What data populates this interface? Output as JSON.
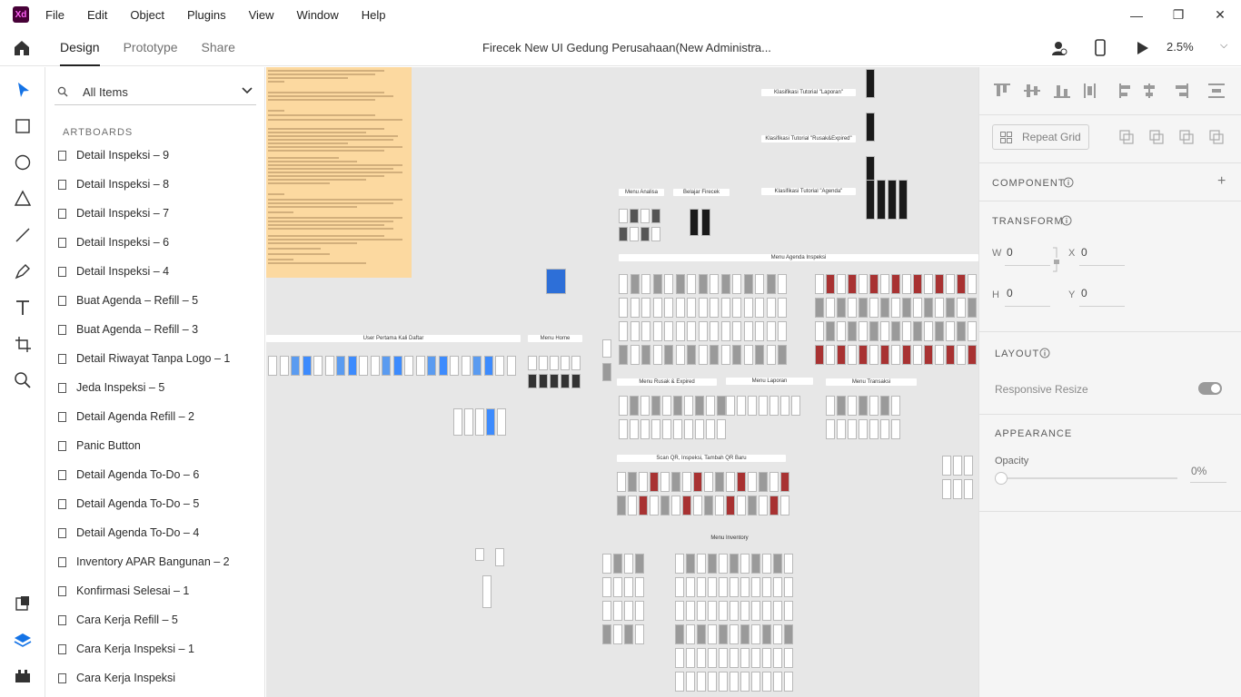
{
  "app": {
    "logo_text": "Xd",
    "brand_color": "#470137"
  },
  "menu": [
    "File",
    "Edit",
    "Object",
    "Plugins",
    "View",
    "Window",
    "Help"
  ],
  "window_controls": {
    "minimize": "—",
    "maximize": "❐",
    "close": "✕"
  },
  "toolbar": {
    "tabs": [
      {
        "label": "Design",
        "active": true
      },
      {
        "label": "Prototype",
        "active": false
      },
      {
        "label": "Share",
        "active": false
      }
    ],
    "doc_title": "Firecek New UI Gedung Perusahaan(New Administra...",
    "zoom": "2.5%"
  },
  "layers": {
    "search_text": "All Items",
    "section": "ARTBOARDS",
    "items": [
      "Detail Inspeksi – 9",
      "Detail Inspeksi – 8",
      "Detail Inspeksi – 7",
      "Detail Inspeksi – 6",
      "Detail Inspeksi – 4",
      "Buat Agenda – Refill – 5",
      "Buat Agenda – Refill – 3",
      "Detail Riwayat Tanpa Logo – 1",
      "Jeda Inspeksi – 5",
      "Detail Agenda Refill – 2",
      "Panic Button",
      "Detail Agenda To-Do – 6",
      "Detail Agenda To-Do – 5",
      "Detail Agenda To-Do – 4",
      "Inventory APAR Bangunan – 2",
      "Konfirmasi Selesai – 1",
      "Cara Kerja Refill – 5",
      "Cara Kerja Inspeksi – 1",
      "Cara Kerja Inspeksi"
    ]
  },
  "canvas": {
    "labels": {
      "user_pertama": "User Pertama Kali Daftar",
      "menu_home": "Menu Home",
      "menu_analisa": "Menu Analisa",
      "belajar": "Belajar Firecek",
      "klasifikasi_laporan": "Klasifikasi Tutorial \"Laporan\"",
      "klasifikasi_rusak": "Klasifikasi Tutorial \"Rusak&Expired\"",
      "klasifikasi_agenda": "Klasifikasi Tutorial \"Agenda\"",
      "menu_agenda": "Menu Agenda Inspeksi",
      "menu_rusak": "Menu Rusak & Expired",
      "menu_laporan": "Menu Laporan",
      "menu_transaksi": "Menu Transaksi",
      "scan_qr": "Scan QR, Inspeksi, Tambah QR Baru",
      "menu_inventory": "Menu Inventory"
    }
  },
  "properties": {
    "repeat_grid": "Repeat Grid",
    "component": "COMPONENT",
    "transform": "TRANSFORM",
    "w_label": "W",
    "w_value": "0",
    "h_label": "H",
    "h_value": "0",
    "x_label": "X",
    "x_value": "0",
    "y_label": "Y",
    "y_value": "0",
    "layout": "LAYOUT",
    "responsive": "Responsive Resize",
    "appearance": "APPEARANCE",
    "opacity_label": "Opacity",
    "opacity_value": "0%"
  }
}
